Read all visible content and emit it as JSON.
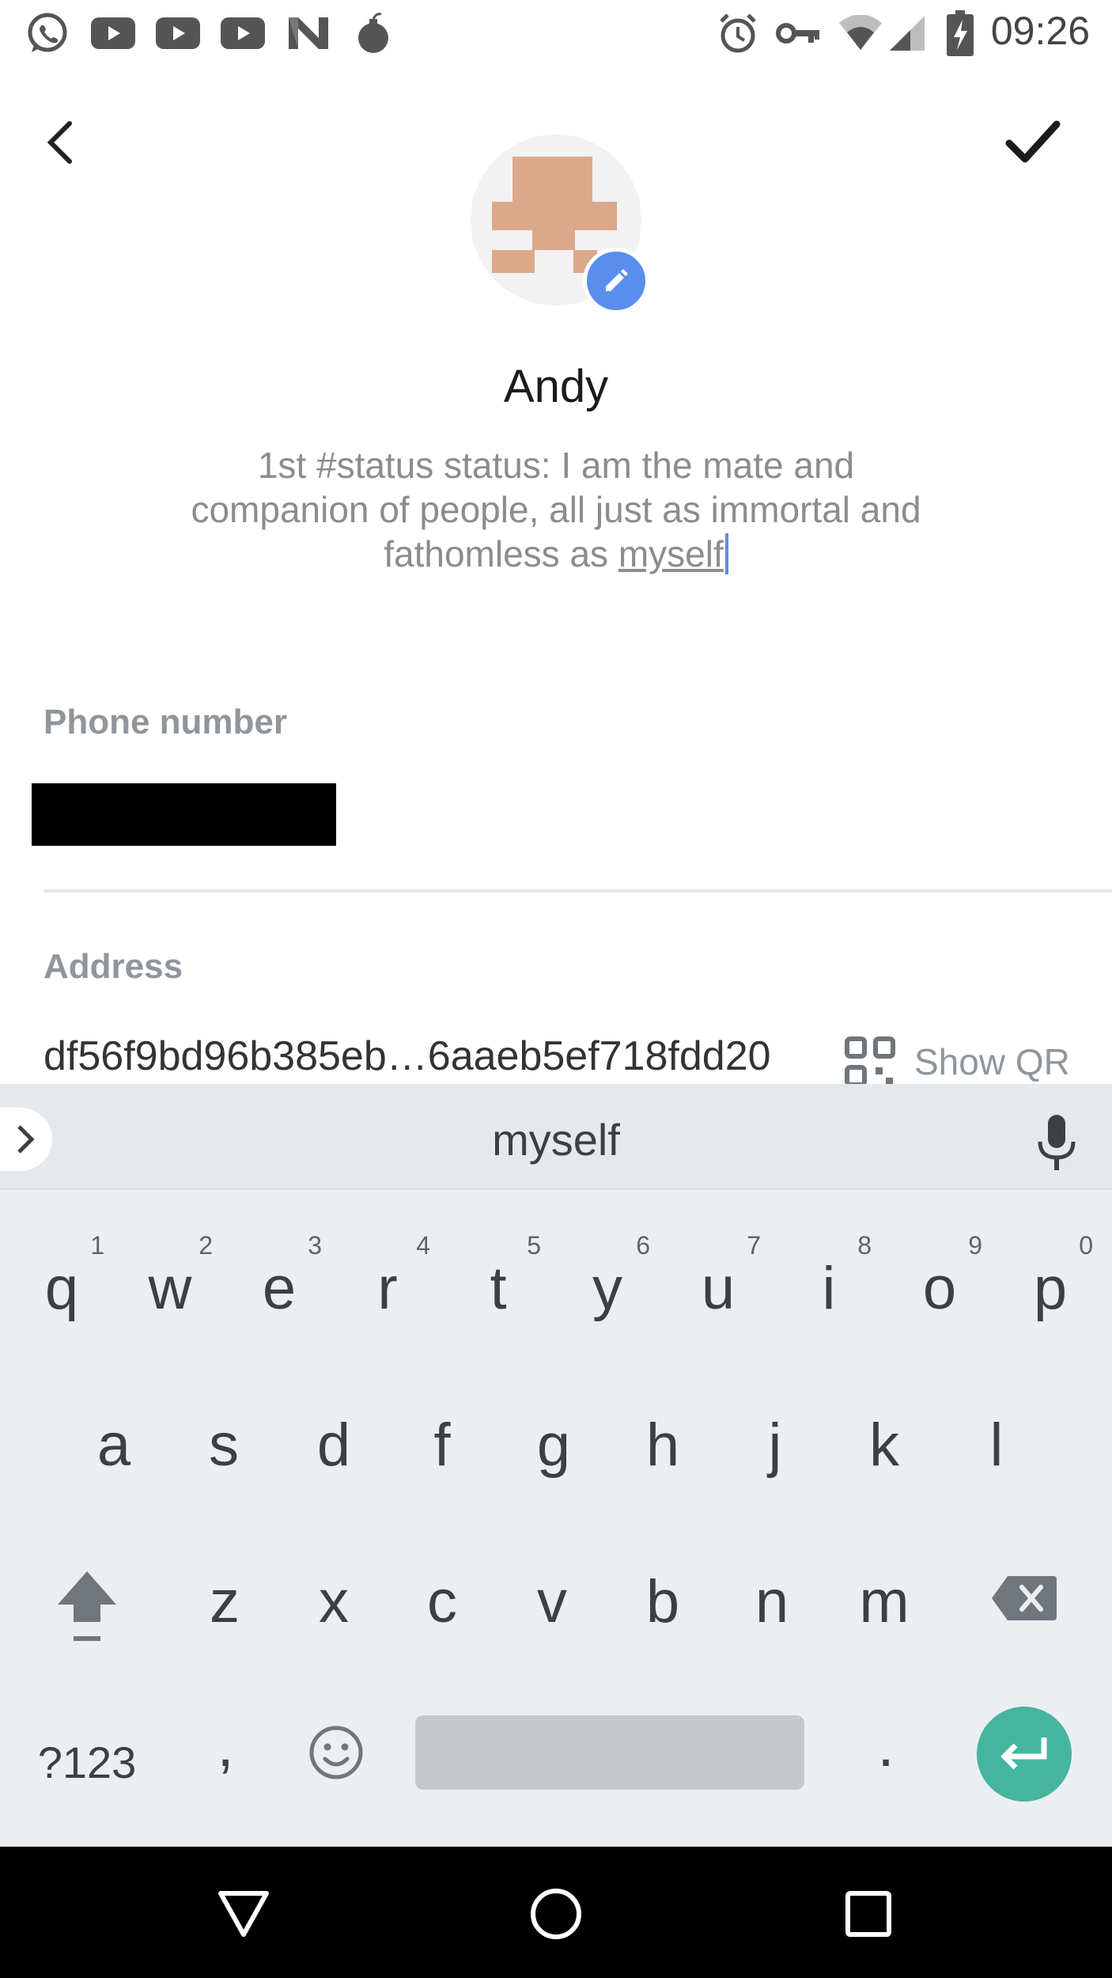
{
  "status_bar": {
    "time": "09:26",
    "left_icons": [
      "whatsapp-icon",
      "youtube-icon",
      "youtube-icon",
      "youtube-icon",
      "n-app-icon",
      "bomb-icon"
    ],
    "right_icons": [
      "alarm-icon",
      "vpn-key-icon",
      "wifi-icon",
      "cell-signal-icon",
      "battery-charging-icon"
    ]
  },
  "profile": {
    "name": "Andy",
    "status_prefix": "1st #status status: I am the mate and companion of people, all just as immortal and fathomless as ",
    "status_current_word": "myself"
  },
  "fields": {
    "phone_label": "Phone number",
    "address_label": "Address",
    "address_value": "df56f9bd96b385eb…6aaeb5ef718fdd20",
    "show_qr_label": "Show QR"
  },
  "keyboard": {
    "suggestion": "myself",
    "row1": [
      {
        "k": "q",
        "h": "1"
      },
      {
        "k": "w",
        "h": "2"
      },
      {
        "k": "e",
        "h": "3"
      },
      {
        "k": "r",
        "h": "4"
      },
      {
        "k": "t",
        "h": "5"
      },
      {
        "k": "y",
        "h": "6"
      },
      {
        "k": "u",
        "h": "7"
      },
      {
        "k": "i",
        "h": "8"
      },
      {
        "k": "o",
        "h": "9"
      },
      {
        "k": "p",
        "h": "0"
      }
    ],
    "row2": [
      "a",
      "s",
      "d",
      "f",
      "g",
      "h",
      "j",
      "k",
      "l"
    ],
    "row3": [
      "z",
      "x",
      "c",
      "v",
      "b",
      "n",
      "m"
    ],
    "symbols_label": "?123",
    "comma_label": ",",
    "period_label": "."
  },
  "colors": {
    "accent_blue": "#5b8def",
    "enter_teal": "#45b5a0",
    "label_gray": "#8f969c"
  }
}
